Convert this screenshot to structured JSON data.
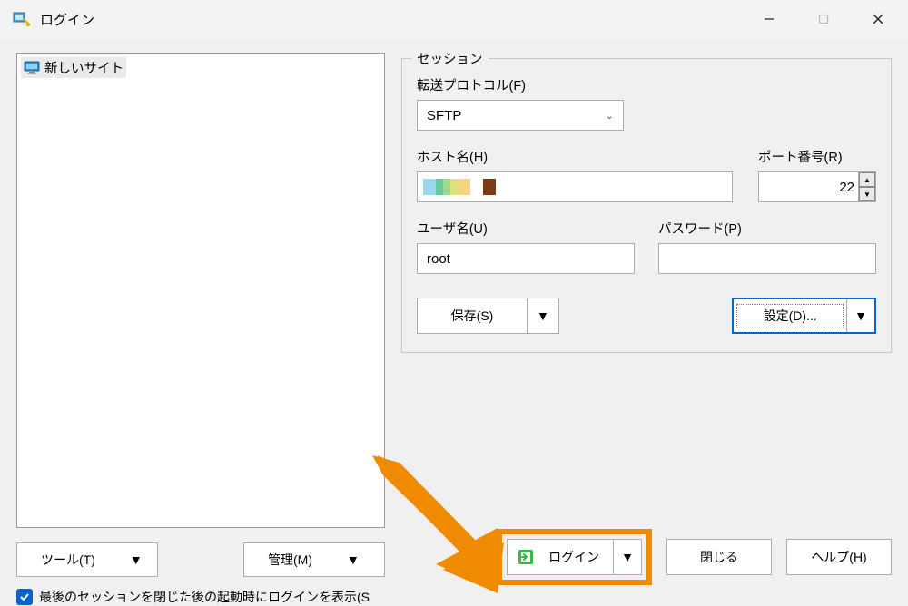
{
  "window": {
    "title": "ログイン"
  },
  "titlebar": {
    "minimize": "−",
    "maximize": "□",
    "close": "×"
  },
  "sites": {
    "items": [
      {
        "label": "新しいサイト"
      }
    ]
  },
  "session": {
    "legend": "セッション",
    "protocol_label": "転送プロトコル(F)",
    "protocol_value": "SFTP",
    "host_label": "ホスト名(H)",
    "host_value": "",
    "port_label": "ポート番号(R)",
    "port_value": "22",
    "user_label": "ユーザ名(U)",
    "user_value": "root",
    "pass_label": "パスワード(P)",
    "pass_value": "",
    "save_label": "保存(S)",
    "settings_label": "設定(D)..."
  },
  "left_buttons": {
    "tools": "ツール(T)",
    "manage": "管理(M)"
  },
  "checkbox": {
    "label": "最後のセッションを閉じた後の起動時にログインを表示(S",
    "checked": true
  },
  "bottom": {
    "login": "ログイン",
    "close": "閉じる",
    "help": "ヘルプ(H)"
  }
}
